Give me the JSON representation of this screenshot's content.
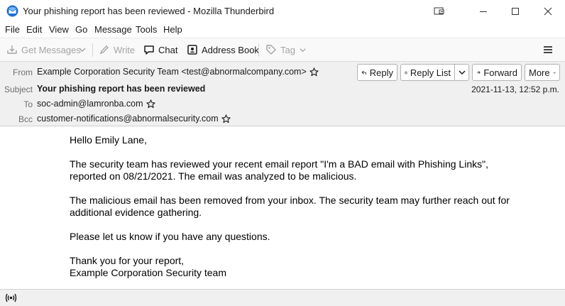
{
  "window": {
    "title": "Your phishing report has been reviewed - Mozilla Thunderbird"
  },
  "menu": {
    "items": [
      "File",
      "Edit",
      "View",
      "Go",
      "Message",
      "Tools",
      "Help"
    ]
  },
  "toolbar": {
    "get_messages": "Get Messages",
    "write": "Write",
    "chat": "Chat",
    "address_book": "Address Book",
    "tag": "Tag"
  },
  "header": {
    "from_label": "From",
    "from_value": "Example Corporation Security Team <test@abnormalcompany.com>",
    "subject_label": "Subject",
    "subject_value": "Your phishing report has been reviewed",
    "to_label": "To",
    "to_value": "soc-admin@lamronba.com",
    "bcc_label": "Bcc",
    "bcc_value": "customer-notifications@abnormalsecurity.com",
    "date": "2021-11-13, 12:52 p.m."
  },
  "actions": {
    "reply": "Reply",
    "reply_list": "Reply List",
    "forward": "Forward",
    "more": "More"
  },
  "body": {
    "greeting": "Hello Emily Lane,",
    "para1": "The security team has reviewed your recent email report \"I'm a BAD email with Phishing Links\", reported on 08/21/2021. The email was analyzed to be malicious.",
    "para2": "The malicious email has been removed from your inbox. The security team may further reach out for additional evidence gathering.",
    "para3": "Please let us know if you have any questions.",
    "closing1": "Thank you for your report,",
    "closing2": "Example Corporation Security team"
  },
  "colors": {
    "accent": "#0a84ff",
    "header_bg": "#f0f0f0",
    "toolbar_bg": "#f9f9fa"
  }
}
